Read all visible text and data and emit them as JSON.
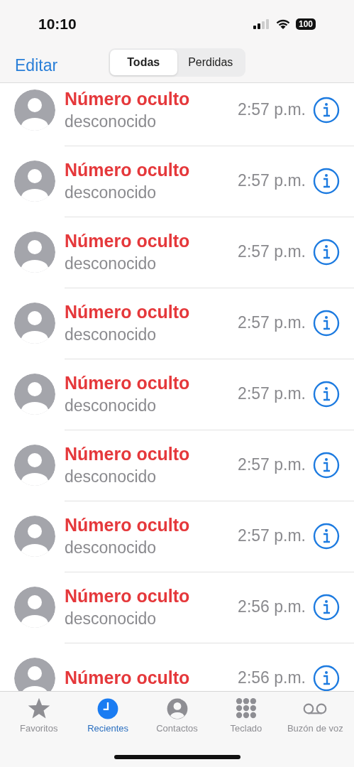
{
  "status_bar": {
    "time": "10:10",
    "battery": "100"
  },
  "nav": {
    "edit": "Editar",
    "segments": [
      {
        "label": "Todas",
        "selected": true
      },
      {
        "label": "Perdidas",
        "selected": false
      }
    ]
  },
  "calls": [
    {
      "name": "Número oculto",
      "subtitle": "desconocido",
      "time": "2:57 p.m."
    },
    {
      "name": "Número oculto",
      "subtitle": "desconocido",
      "time": "2:57 p.m."
    },
    {
      "name": "Número oculto",
      "subtitle": "desconocido",
      "time": "2:57 p.m."
    },
    {
      "name": "Número oculto",
      "subtitle": "desconocido",
      "time": "2:57 p.m."
    },
    {
      "name": "Número oculto",
      "subtitle": "desconocido",
      "time": "2:57 p.m."
    },
    {
      "name": "Número oculto",
      "subtitle": "desconocido",
      "time": "2:57 p.m."
    },
    {
      "name": "Número oculto",
      "subtitle": "desconocido",
      "time": "2:57 p.m."
    },
    {
      "name": "Número oculto",
      "subtitle": "desconocido",
      "time": "2:56 p.m."
    },
    {
      "name": "Número oculto",
      "time": "2:56 p.m."
    }
  ],
  "tab_bar": [
    {
      "kind": "star",
      "label": "Favoritos",
      "selected": false
    },
    {
      "kind": "clock",
      "label": "Recientes",
      "selected": true
    },
    {
      "kind": "person",
      "label": "Contactos",
      "selected": false
    },
    {
      "kind": "keypad",
      "label": "Teclado",
      "selected": false
    },
    {
      "kind": "voicemail",
      "label": "Buzón de voz",
      "selected": false
    }
  ]
}
